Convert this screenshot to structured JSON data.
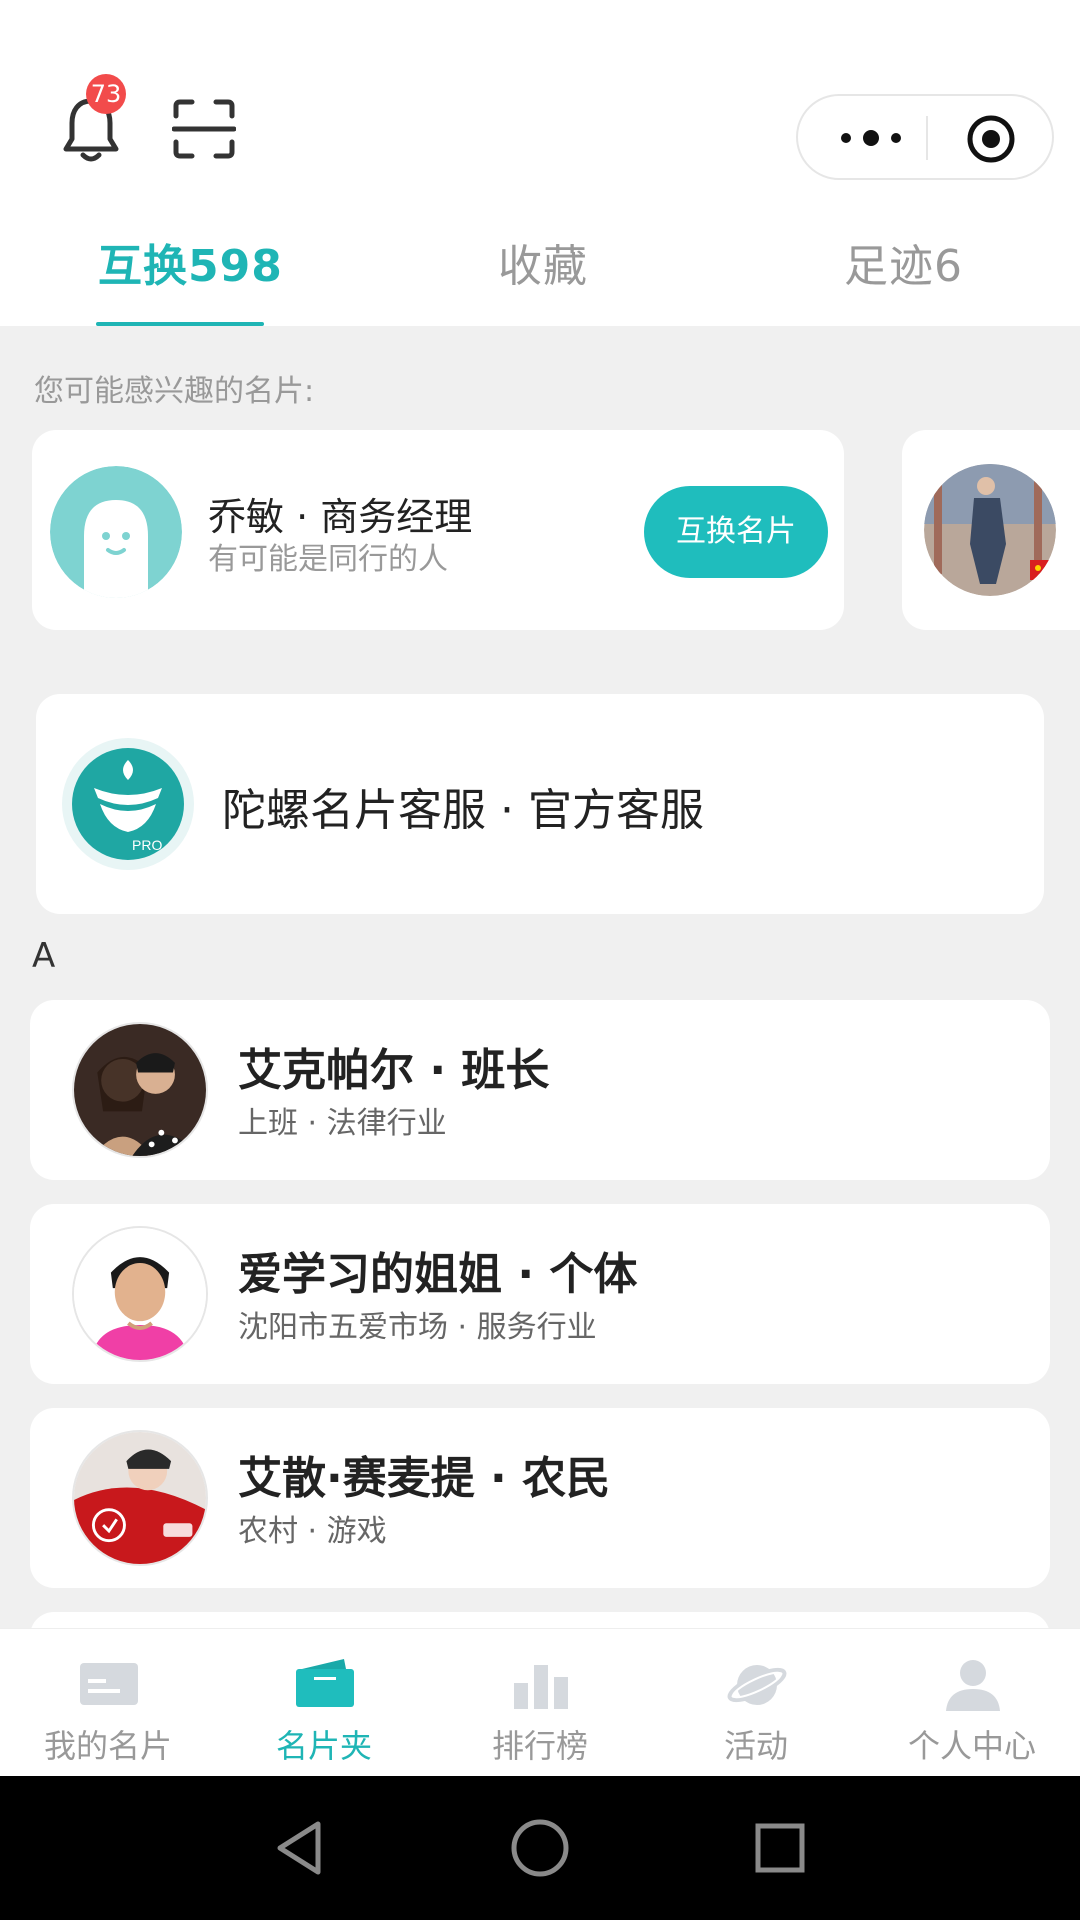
{
  "header": {
    "notification_count": "73",
    "tabs": [
      {
        "label": "互换598",
        "active": true
      },
      {
        "label": "收藏",
        "active": false
      },
      {
        "label": "足迹6",
        "active": false
      }
    ]
  },
  "recommend": {
    "hint": "您可能感兴趣的名片:",
    "cards": [
      {
        "title": "乔敏 · 商务经理",
        "subtitle": "有可能是同行的人",
        "button": "互换名片"
      }
    ]
  },
  "service": {
    "label": "陀螺名片客服 · 官方客服",
    "logo_tag": "PRO"
  },
  "index_letter": "A",
  "contacts": [
    {
      "name": "艾克帕尔 · 班长",
      "detail": "上班 · 法律行业"
    },
    {
      "name": "爱学习的姐姐 · 个体",
      "detail": "沈阳市五爱市场 · 服务行业"
    },
    {
      "name": "艾散·赛麦提 · 农民",
      "detail": "农村 · 游戏"
    }
  ],
  "tabbar": {
    "items": [
      {
        "label": "我的名片",
        "icon": "card-icon",
        "active": false
      },
      {
        "label": "名片夹",
        "icon": "wallet-icon",
        "active": true
      },
      {
        "label": "排行榜",
        "icon": "bar-chart-icon",
        "active": false
      },
      {
        "label": "活动",
        "icon": "planet-icon",
        "active": false
      },
      {
        "label": "个人中心",
        "icon": "person-icon",
        "active": false
      }
    ]
  },
  "colors": {
    "accent": "#1fb5b5",
    "badge": "#f24b4b",
    "background": "#f0f0f0"
  }
}
